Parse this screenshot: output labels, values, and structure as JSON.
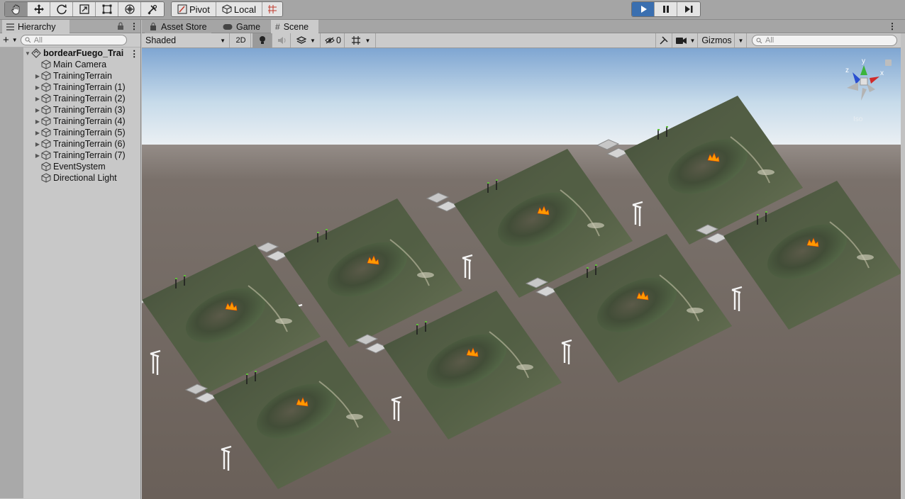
{
  "toolbar": {
    "tools": [
      "hand-tool",
      "move-tool",
      "rotate-tool",
      "scale-tool",
      "rect-tool",
      "transform-tool",
      "custom-tool"
    ],
    "pivot_label": "Pivot",
    "local_label": "Local",
    "grid_snap": "grid-snap",
    "play": [
      "play",
      "pause",
      "step"
    ]
  },
  "hierarchy": {
    "tab_label": "Hierarchy",
    "search_placeholder": "All",
    "scene_name": "bordearFuego_Trai",
    "items": [
      {
        "label": "Main Camera",
        "expandable": false
      },
      {
        "label": "TrainingTerrain",
        "expandable": true
      },
      {
        "label": "TrainingTerrain (1)",
        "expandable": true
      },
      {
        "label": "TrainingTerrain (2)",
        "expandable": true
      },
      {
        "label": "TrainingTerrain (3)",
        "expandable": true
      },
      {
        "label": "TrainingTerrain (4)",
        "expandable": true
      },
      {
        "label": "TrainingTerrain (5)",
        "expandable": true
      },
      {
        "label": "TrainingTerrain (6)",
        "expandable": true
      },
      {
        "label": "TrainingTerrain (7)",
        "expandable": true
      },
      {
        "label": "EventSystem",
        "expandable": false
      },
      {
        "label": "Directional Light",
        "expandable": false
      }
    ]
  },
  "scene_tabs": {
    "asset_store": "Asset Store",
    "game": "Game",
    "scene": "Scene"
  },
  "scene_toolbar": {
    "shading_mode": "Shaded",
    "mode_2d": "2D",
    "hidden_count": "0",
    "gizmos_label": "Gizmos",
    "search_placeholder": "All"
  },
  "scene_gizmo": {
    "axis_x": "x",
    "axis_y": "y",
    "axis_z": "z",
    "projection": "Iso"
  },
  "colors": {
    "play_active": "#3a6fb0",
    "sky_top": "#8fb1d6",
    "ground": "#6e645d",
    "fire": "#ff9a00"
  }
}
